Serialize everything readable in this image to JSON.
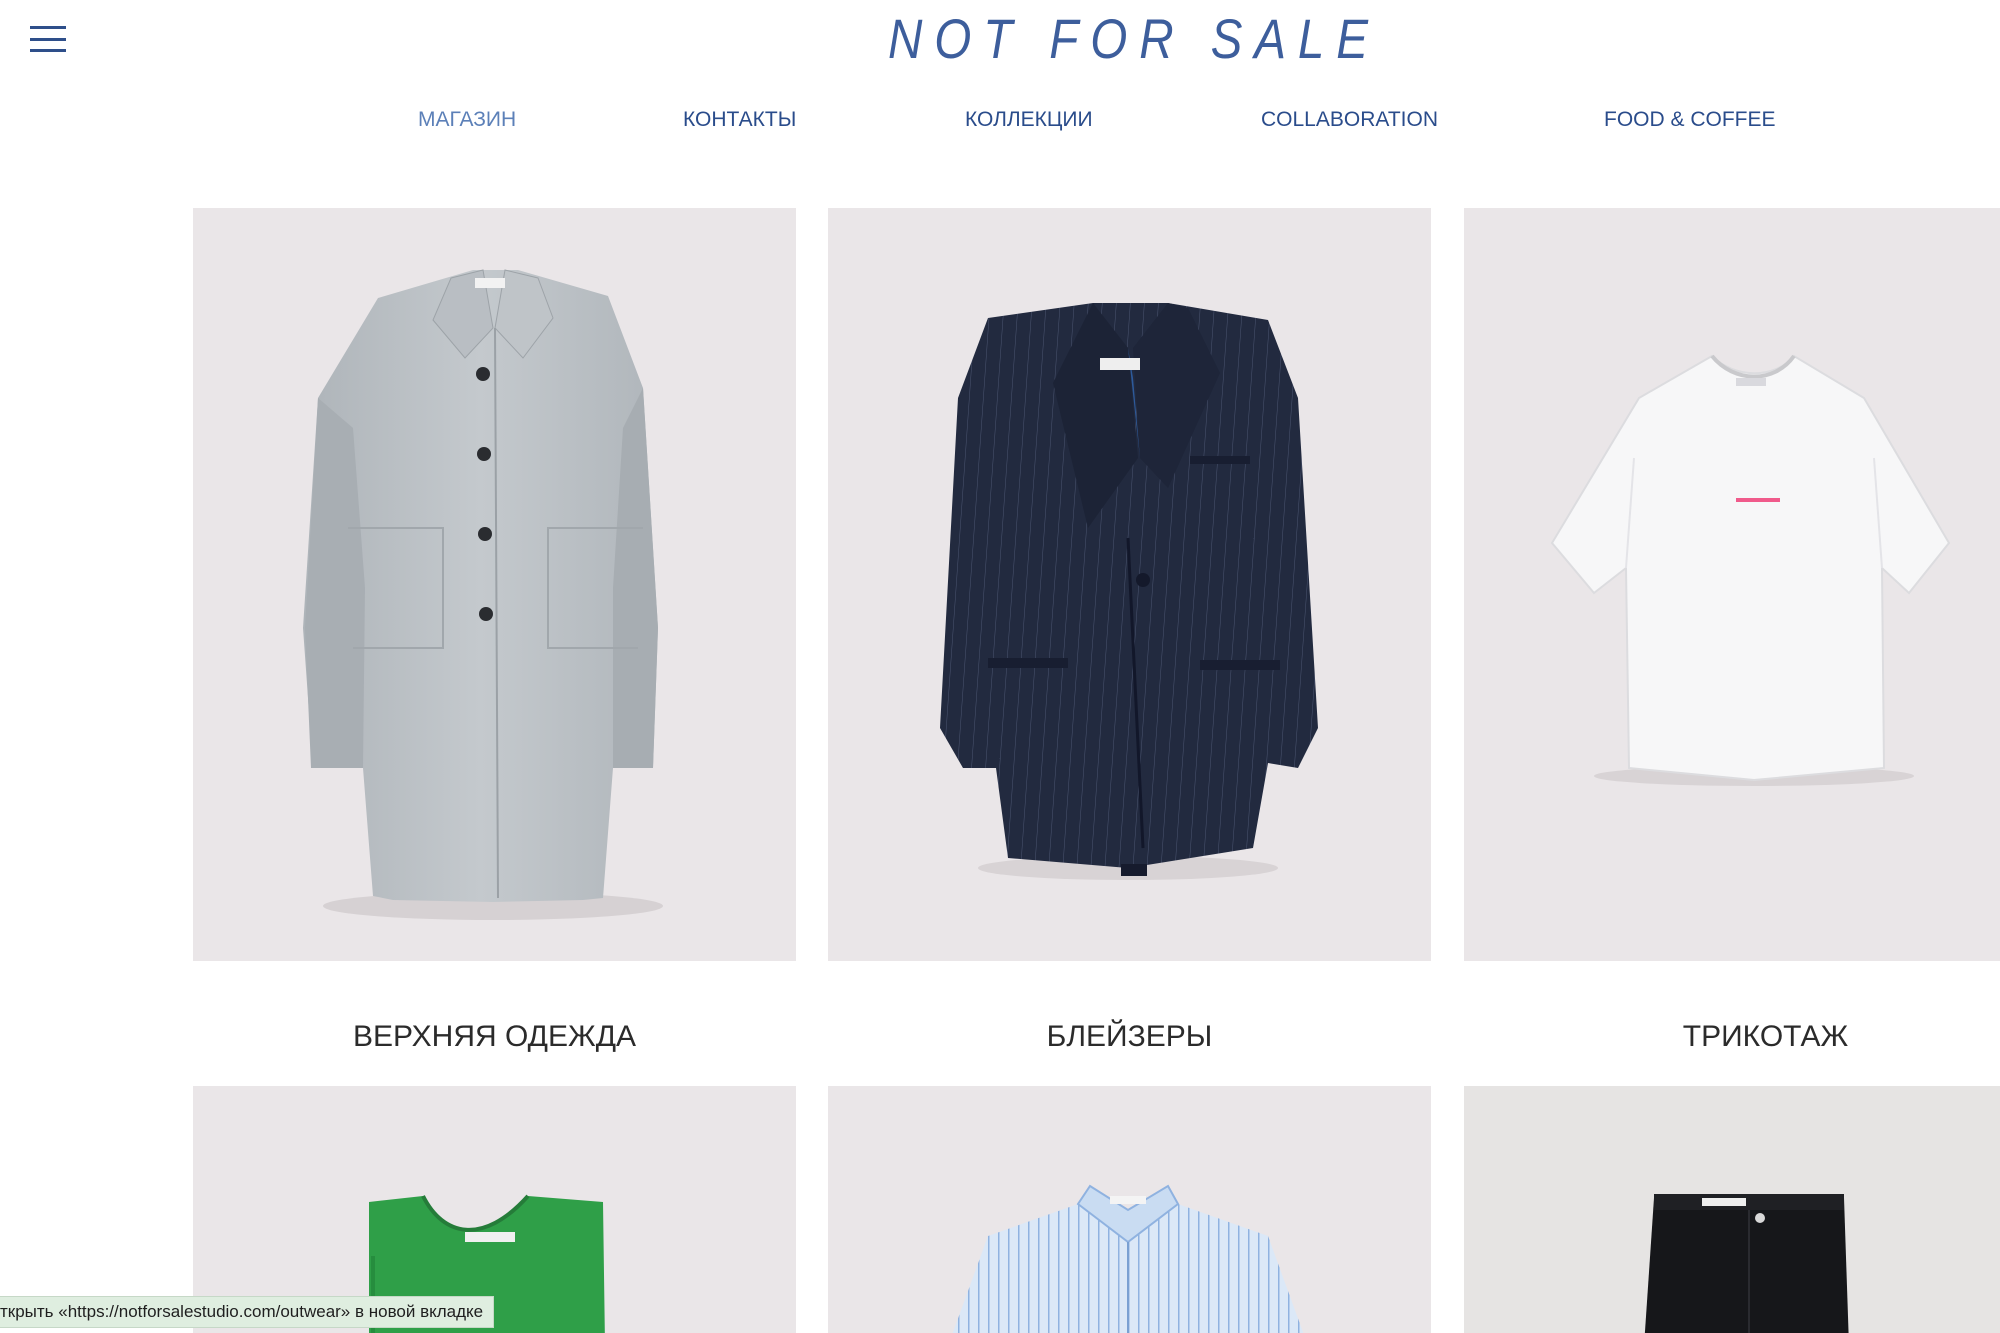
{
  "header": {
    "logo": "NOT FOR SALE",
    "menu_icon": "hamburger-menu-icon"
  },
  "nav": {
    "items": [
      {
        "label": "МАГАЗИН",
        "active": true
      },
      {
        "label": "КОНТАКТЫ",
        "active": false
      },
      {
        "label": "КОЛЛЕКЦИИ",
        "active": false
      },
      {
        "label": "COLLABORATION",
        "active": false
      },
      {
        "label": "FOOD & COFFEE",
        "active": false
      }
    ]
  },
  "categories": [
    {
      "label": "ВЕРХНЯЯ ОДЕЖДА",
      "image": "grey-coat"
    },
    {
      "label": "БЛЕЙЗЕРЫ",
      "image": "navy-pinstripe-blazer"
    },
    {
      "label": "ТРИКОТАЖ",
      "image": "white-tshirt"
    },
    {
      "label": "",
      "image": "green-top"
    },
    {
      "label": "",
      "image": "striped-shirt"
    },
    {
      "label": "",
      "image": "black-trousers"
    }
  ],
  "status_bar": {
    "text": "ткрыть «https://notforsalestudio.com/outwear» в новой вкладке"
  },
  "colors": {
    "brand_blue": "#3d5e9c",
    "nav_text": "#2a4c8b",
    "nav_active": "#5c80b8",
    "tile_bg": "#eae6e8"
  }
}
